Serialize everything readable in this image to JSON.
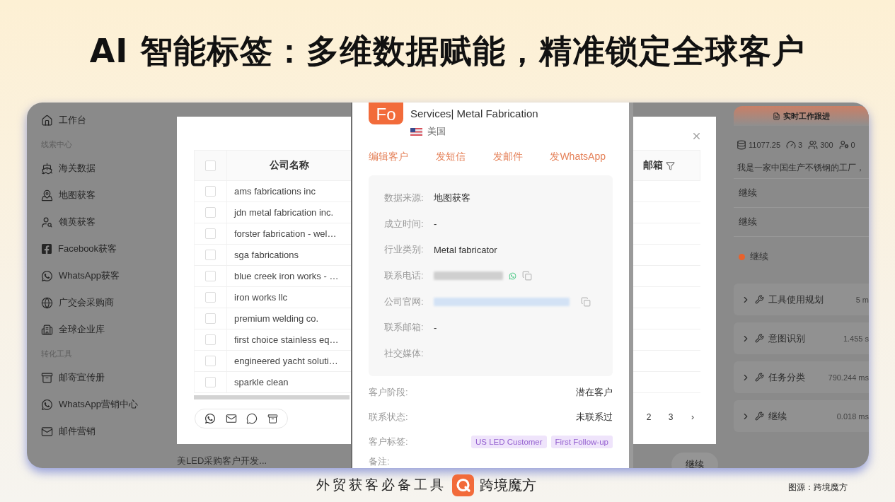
{
  "slide_title": "AI 智能标签：多维数据赋能，精准锁定全球客户",
  "sidebar": [
    {
      "kind": "item",
      "label": "工作台"
    },
    {
      "kind": "section",
      "label": "线索中心"
    },
    {
      "kind": "item",
      "label": "海关数据"
    },
    {
      "kind": "item",
      "label": "地图获客"
    },
    {
      "kind": "item",
      "label": "领英获客"
    },
    {
      "kind": "item",
      "label": "Facebook获客"
    },
    {
      "kind": "item",
      "label": "WhatsApp获客"
    },
    {
      "kind": "item",
      "label": "广交会采购商"
    },
    {
      "kind": "item",
      "label": "全球企业库"
    },
    {
      "kind": "section",
      "label": "转化工具"
    },
    {
      "kind": "item",
      "label": "邮寄宣传册"
    },
    {
      "kind": "item",
      "label": "WhatsApp营销中心"
    },
    {
      "kind": "item",
      "label": "邮件营销"
    }
  ],
  "background": {
    "task_name": "美LED采购客户开发...",
    "continue_button": "继续"
  },
  "modal": {
    "columns": [
      "公司名称",
      "邮箱"
    ],
    "header_checked": false,
    "rows": [
      {
        "name": "ams fabrications inc",
        "checked": false
      },
      {
        "name": "jdn metal fabrication inc.",
        "checked": false
      },
      {
        "name": "forster fabrication - wel…",
        "checked": false
      },
      {
        "name": "sga fabrications",
        "checked": false
      },
      {
        "name": "blue creek iron works - …",
        "checked": false
      },
      {
        "name": "iron works llc",
        "checked": false
      },
      {
        "name": "premium welding co.",
        "checked": false
      },
      {
        "name": "first choice stainless eq…",
        "checked": false
      },
      {
        "name": "engineered yacht soluti…",
        "checked": false
      },
      {
        "name": "sparkle clean",
        "checked": false
      }
    ],
    "pages": [
      "2",
      "3"
    ],
    "next": "›"
  },
  "detail": {
    "avatar": "Fo",
    "name": "Services| Metal Fabrication",
    "country": "美国",
    "actions": [
      "编辑客户",
      "发短信",
      "发邮件",
      "发WhatsApp"
    ],
    "info": [
      {
        "kind": "text",
        "label": "数据来源:",
        "value": "地图获客"
      },
      {
        "kind": "text",
        "label": "成立时间:",
        "value": "-"
      },
      {
        "kind": "text",
        "label": "行业类别:",
        "value": "Metal fabricator"
      },
      {
        "kind": "phone",
        "label": "联系电话:"
      },
      {
        "kind": "website",
        "label": "公司官网:"
      },
      {
        "kind": "text",
        "label": "联系邮箱:",
        "value": "-"
      },
      {
        "kind": "text",
        "label": "社交媒体:"
      }
    ],
    "fields": [
      {
        "label": "客户阶段:",
        "value": "潜在客户"
      },
      {
        "label": "联系状态:",
        "value": "未联系过"
      }
    ],
    "tags_label": "客户标签:",
    "tags": [
      "US LED Customer",
      "First Follow-up"
    ],
    "note_label": "备注:"
  },
  "panel": {
    "title": "实时工作跟进",
    "stats": [
      "11077.25",
      "3",
      "300",
      "0"
    ],
    "prompt": "我是一家中国生产不锈钢的工厂，",
    "replies": [
      "继续",
      "继续"
    ],
    "status": {
      "label": "继续",
      "color": "#e8622c"
    },
    "steps": [
      {
        "label": "工具使用规划",
        "time": "5 m",
        "expanded": false
      },
      {
        "label": "意图识别",
        "time": "1.455 s",
        "expanded": false
      },
      {
        "label": "任务分类",
        "time": "790.244 ms",
        "expanded": false
      },
      {
        "label": "继续",
        "time": "0.018 ms",
        "expanded": false
      }
    ]
  },
  "footer": {
    "slogan": "外贸获客必备工具",
    "brand": "跨境魔方",
    "source": "图源：跨境魔方"
  }
}
